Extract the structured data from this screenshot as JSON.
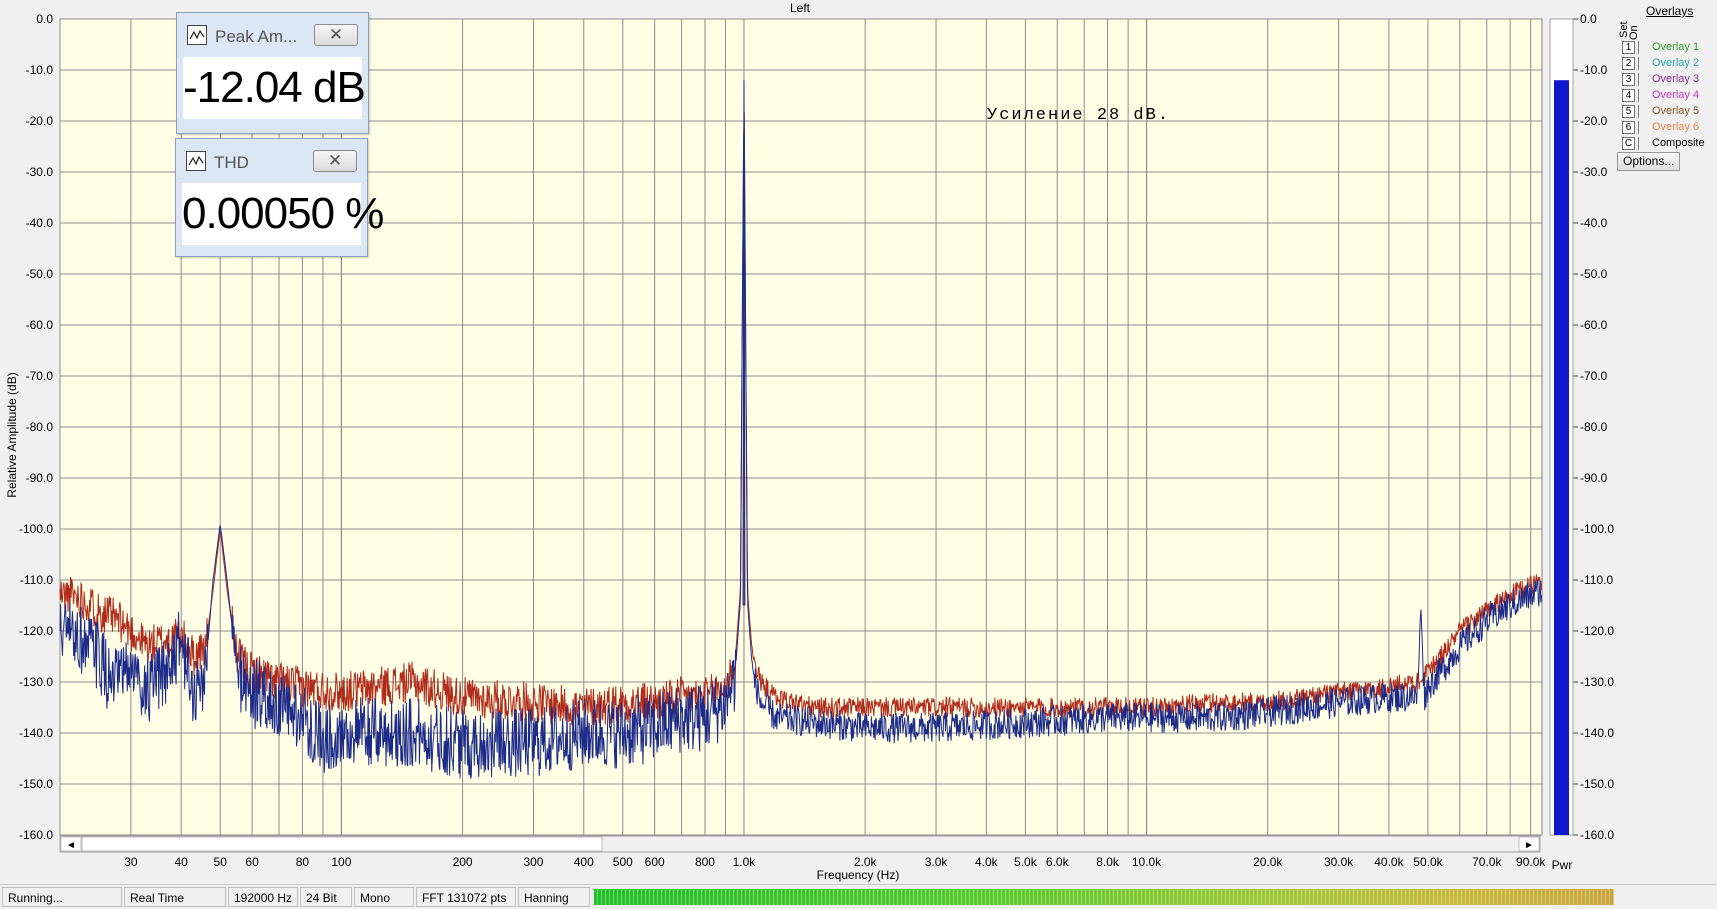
{
  "chart_data": {
    "type": "line",
    "title": "Left",
    "xlabel": "Frequency (Hz)",
    "ylabel": "Relative Amplitude (dB)",
    "x_scale": "log",
    "xlim": [
      20,
      96000
    ],
    "ylim": [
      -160,
      0
    ],
    "grid": true,
    "annotation": "Усиление 28 dB.",
    "x_ticks": [
      {
        "v": 30,
        "t": "30"
      },
      {
        "v": 40,
        "t": "40"
      },
      {
        "v": 50,
        "t": "50"
      },
      {
        "v": 60,
        "t": "60"
      },
      {
        "v": 80,
        "t": "80"
      },
      {
        "v": 100,
        "t": "100"
      },
      {
        "v": 200,
        "t": "200"
      },
      {
        "v": 300,
        "t": "300"
      },
      {
        "v": 400,
        "t": "400"
      },
      {
        "v": 500,
        "t": "500"
      },
      {
        "v": 600,
        "t": "600"
      },
      {
        "v": 800,
        "t": "800"
      },
      {
        "v": 1000,
        "t": "1.0k"
      },
      {
        "v": 2000,
        "t": "2.0k"
      },
      {
        "v": 3000,
        "t": "3.0k"
      },
      {
        "v": 4000,
        "t": "4.0k"
      },
      {
        "v": 5000,
        "t": "5.0k"
      },
      {
        "v": 6000,
        "t": "6.0k"
      },
      {
        "v": 8000,
        "t": "8.0k"
      },
      {
        "v": 10000,
        "t": "10.0k"
      },
      {
        "v": 20000,
        "t": "20.0k"
      },
      {
        "v": 30000,
        "t": "30.0k"
      },
      {
        "v": 40000,
        "t": "40.0k"
      },
      {
        "v": 50000,
        "t": "50.0k"
      },
      {
        "v": 70000,
        "t": "70.0k"
      },
      {
        "v": 90000,
        "t": "90.0k"
      }
    ],
    "y_ticks": [
      "0.0",
      "-10.0",
      "-20.0",
      "-30.0",
      "-40.0",
      "-50.0",
      "-60.0",
      "-70.0",
      "-80.0",
      "-90.0",
      "-100.0",
      "-110.0",
      "-120.0",
      "-130.0",
      "-140.0",
      "-150.0",
      "-160.0"
    ],
    "series": [
      {
        "color": "#b22a1a",
        "points": [
          [
            20,
            -113
          ],
          [
            22,
            -113
          ],
          [
            25,
            -116
          ],
          [
            28,
            -118
          ],
          [
            30,
            -120
          ],
          [
            33,
            -123
          ],
          [
            36,
            -122
          ],
          [
            40,
            -121
          ],
          [
            43,
            -125
          ],
          [
            46,
            -123
          ],
          [
            48,
            -112
          ],
          [
            50,
            -100
          ],
          [
            52,
            -112
          ],
          [
            55,
            -125
          ],
          [
            60,
            -128
          ],
          [
            70,
            -130
          ],
          [
            80,
            -131
          ],
          [
            100,
            -132
          ],
          [
            150,
            -130
          ],
          [
            200,
            -133
          ],
          [
            300,
            -134
          ],
          [
            400,
            -135
          ],
          [
            500,
            -134
          ],
          [
            600,
            -134
          ],
          [
            700,
            -133
          ],
          [
            800,
            -133
          ],
          [
            900,
            -131
          ],
          [
            950,
            -126
          ],
          [
            980,
            -112
          ],
          [
            1000,
            -12
          ],
          [
            1020,
            -112
          ],
          [
            1050,
            -125
          ],
          [
            1100,
            -130
          ],
          [
            1200,
            -133
          ],
          [
            1500,
            -135
          ],
          [
            2000,
            -135
          ],
          [
            3000,
            -135
          ],
          [
            5000,
            -135
          ],
          [
            8000,
            -135
          ],
          [
            10000,
            -135
          ],
          [
            15000,
            -134
          ],
          [
            20000,
            -134
          ],
          [
            30000,
            -132
          ],
          [
            40000,
            -131
          ],
          [
            45000,
            -130
          ],
          [
            48000,
            -130
          ],
          [
            50000,
            -128
          ],
          [
            55000,
            -124
          ],
          [
            60000,
            -120
          ],
          [
            70000,
            -116
          ],
          [
            80000,
            -113
          ],
          [
            90000,
            -111
          ],
          [
            96000,
            -110
          ]
        ]
      },
      {
        "color": "#1c2a8a",
        "points": [
          [
            20,
            -120
          ],
          [
            22,
            -121
          ],
          [
            25,
            -125
          ],
          [
            27,
            -131
          ],
          [
            30,
            -127
          ],
          [
            33,
            -132
          ],
          [
            36,
            -129
          ],
          [
            40,
            -122
          ],
          [
            43,
            -133
          ],
          [
            46,
            -128
          ],
          [
            48,
            -110
          ],
          [
            50,
            -99
          ],
          [
            52,
            -110
          ],
          [
            55,
            -128
          ],
          [
            60,
            -132
          ],
          [
            70,
            -135
          ],
          [
            80,
            -137
          ],
          [
            90,
            -141
          ],
          [
            100,
            -140
          ],
          [
            150,
            -140
          ],
          [
            200,
            -142
          ],
          [
            300,
            -142
          ],
          [
            400,
            -140
          ],
          [
            500,
            -140
          ],
          [
            600,
            -139
          ],
          [
            700,
            -137
          ],
          [
            800,
            -137
          ],
          [
            900,
            -134
          ],
          [
            950,
            -129
          ],
          [
            980,
            -114
          ],
          [
            1000,
            -12
          ],
          [
            1020,
            -114
          ],
          [
            1050,
            -128
          ],
          [
            1100,
            -134
          ],
          [
            1200,
            -137
          ],
          [
            1500,
            -138
          ],
          [
            2000,
            -139
          ],
          [
            3000,
            -139
          ],
          [
            5000,
            -138
          ],
          [
            8000,
            -137
          ],
          [
            10000,
            -137
          ],
          [
            15000,
            -137
          ],
          [
            20000,
            -136
          ],
          [
            30000,
            -134
          ],
          [
            40000,
            -133
          ],
          [
            47000,
            -133
          ],
          [
            48000,
            -115
          ],
          [
            49000,
            -133
          ],
          [
            50000,
            -131
          ],
          [
            55000,
            -127
          ],
          [
            60000,
            -123
          ],
          [
            70000,
            -118
          ],
          [
            80000,
            -115
          ],
          [
            90000,
            -113
          ],
          [
            96000,
            -112
          ]
        ]
      }
    ]
  },
  "pwr_bar": {
    "level_db": -12,
    "label": "Pwr",
    "color": "#1018cc"
  },
  "meters": [
    {
      "title": "Peak Am...",
      "value": "-12.04 dB"
    },
    {
      "title": "THD",
      "value": "0.00050 %"
    }
  ],
  "overlays": {
    "title": "Overlays",
    "col_set": "Set",
    "col_on": "On",
    "items": [
      {
        "key": "1",
        "label": "Overlay 1",
        "color": "#2e9a2e"
      },
      {
        "key": "2",
        "label": "Overlay 2",
        "color": "#2aa5b8"
      },
      {
        "key": "3",
        "label": "Overlay 3",
        "color": "#8b2b8b"
      },
      {
        "key": "4",
        "label": "Overlay 4",
        "color": "#c233c2"
      },
      {
        "key": "5",
        "label": "Overlay 5",
        "color": "#8a5a2a"
      },
      {
        "key": "6",
        "label": "Overlay 6",
        "color": "#e0894a"
      },
      {
        "key": "C",
        "label": "Composite",
        "color": "#000000"
      }
    ],
    "options_label": "Options..."
  },
  "status": {
    "state": "Running...",
    "mode": "Real Time",
    "rate": "192000 Hz",
    "bits": "24 Bit",
    "channels": "Mono",
    "fft": "FFT 131072 pts",
    "window": "Hanning"
  },
  "scroll": {
    "left": "◄",
    "right": "►"
  }
}
